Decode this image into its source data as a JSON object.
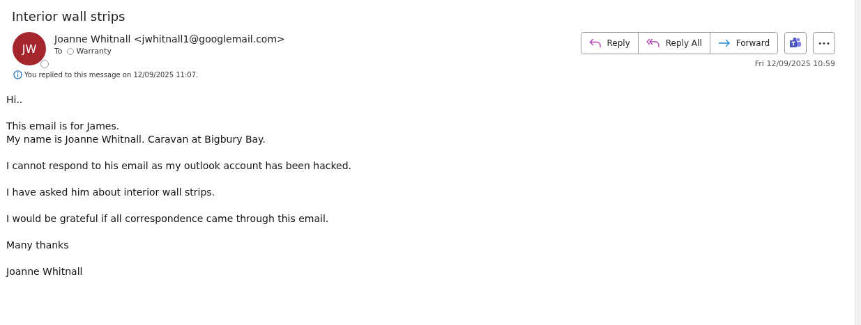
{
  "subject": "Interior wall strips",
  "sender": {
    "initials": "JW",
    "name": "Joanne Whitnall",
    "address": "<jwhitnall1@googlemail.com>"
  },
  "to_label": "To",
  "recipients": [
    "Warranty"
  ],
  "info": "You replied to this message on 12/09/2025 11:07.",
  "actions": [
    "Reply",
    "Reply All",
    "Forward"
  ],
  "more": "•••",
  "date": "Fri 12/09/2025 10:59",
  "body": [
    [
      "Hi.."
    ],
    [
      "This email is for James.",
      "My name is Joanne Whitnall. Caravan at Bigbury Bay."
    ],
    [
      "I cannot respond to his email as my outlook account has been hacked."
    ],
    [
      "I have asked him about interior wall strips."
    ],
    [
      "I would be grateful if all correspondence came through this email."
    ],
    [
      "Many thanks"
    ],
    [
      "Joanne Whitnall"
    ]
  ]
}
